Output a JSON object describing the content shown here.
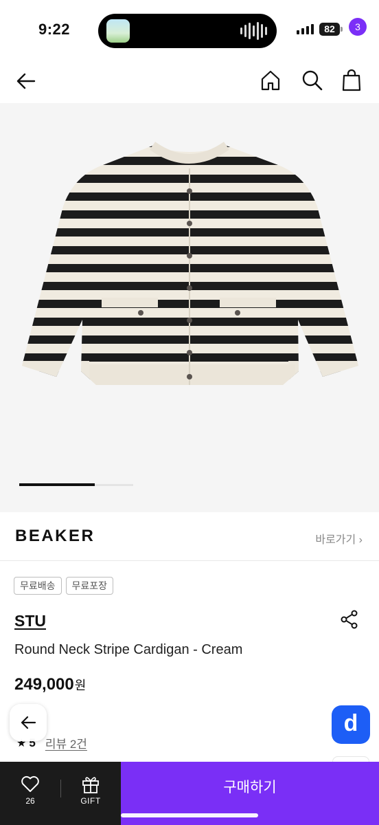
{
  "status_bar": {
    "time": "9:22",
    "battery": "82",
    "icons": [
      "signal-icon",
      "battery-icon",
      "now-playing-waveform-icon"
    ]
  },
  "nav": {
    "icons": [
      "back-arrow-icon",
      "home-icon",
      "search-icon",
      "shopping-bag-icon"
    ],
    "cart_count": "3"
  },
  "product_image": {
    "description_icon": "striped-cardigan-image",
    "carousel_progress": 0.66
  },
  "brand": {
    "logo": "BEAKER",
    "link_label": "바로가기 ›"
  },
  "tags": [
    "무료배송",
    "무료포장"
  ],
  "product": {
    "seller": "STU",
    "title": "Round Neck Stripe Cardigan - Cream",
    "price": "249,000",
    "price_unit": "원"
  },
  "rating": {
    "score": "5",
    "reviews": "리뷰 2건"
  },
  "floating": {
    "d_button": "d"
  },
  "bottom_bar": {
    "like_count": "26",
    "gift_label": "GIFT",
    "buy_label": "구매하기"
  },
  "colors": {
    "accent": "#7a2ff6",
    "badge": "#7b2ff7",
    "floating_button": "#1d5ef6",
    "bottom_dark": "#1b1b1b"
  }
}
